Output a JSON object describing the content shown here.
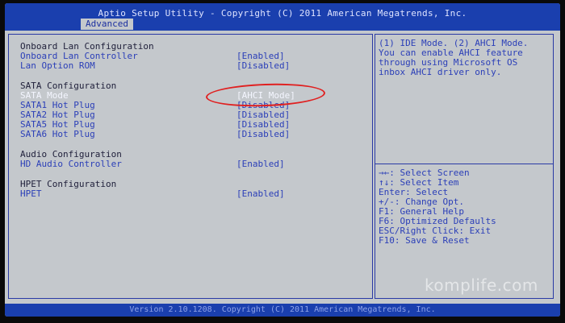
{
  "header": {
    "title": "Aptio Setup Utility - Copyright (C) 2011 American Megatrends, Inc.",
    "active_tab": "Advanced"
  },
  "menu": {
    "sections": [
      {
        "title": "Onboard Lan Configuration",
        "items": [
          {
            "label": "Onboard Lan Controller",
            "value": "[Enabled]"
          },
          {
            "label": "Lan Option ROM",
            "value": "[Disabled]"
          }
        ]
      },
      {
        "title": "SATA Configuration",
        "items": [
          {
            "label": "SATA Mode",
            "value": "[AHCI Mode]",
            "selected": true
          },
          {
            "label": "SATA1 Hot Plug",
            "value": "[Disabled]"
          },
          {
            "label": "SATA2 Hot Plug",
            "value": "[Disabled]"
          },
          {
            "label": "SATA5 Hot Plug",
            "value": "[Disabled]"
          },
          {
            "label": "SATA6 Hot Plug",
            "value": "[Disabled]"
          }
        ]
      },
      {
        "title": "Audio Configuration",
        "items": [
          {
            "label": "HD Audio Controller",
            "value": "[Enabled]"
          }
        ]
      },
      {
        "title": "HPET Configuration",
        "items": [
          {
            "label": "HPET",
            "value": "[Enabled]"
          }
        ]
      }
    ]
  },
  "help": {
    "lines": [
      "(1) IDE Mode. (2) AHCI Mode.",
      "You can enable AHCI feature",
      "through using Microsoft OS",
      "inbox AHCI driver only."
    ]
  },
  "keys": [
    "→←: Select Screen",
    "↑↓: Select Item",
    "Enter: Select",
    "+/-: Change Opt.",
    "F1: General Help",
    "F6: Optimized Defaults",
    "ESC/Right Click: Exit",
    "F10: Save & Reset"
  ],
  "footer": {
    "text": "Version 2.10.1208. Copyright (C) 2011 American Megatrends, Inc."
  },
  "watermark": "komplife.com",
  "colors": {
    "header_bg": "#1a3fae",
    "panel_bg": "#c4c8cc",
    "item_text": "#2b3fb8",
    "annotation": "#e02020"
  }
}
